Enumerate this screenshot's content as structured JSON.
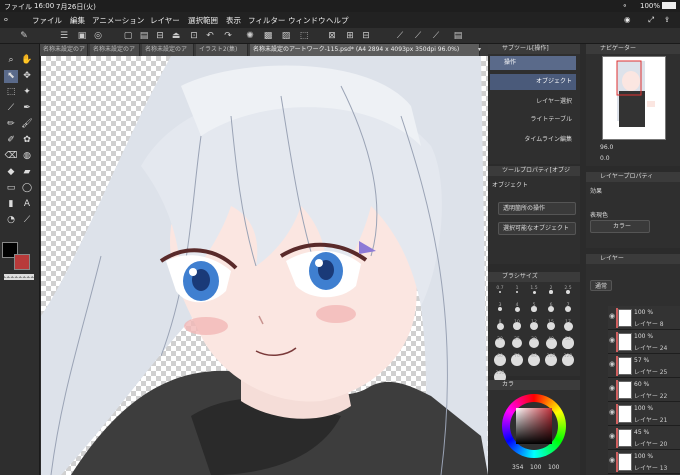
{
  "status": {
    "app": "ファイル",
    "time": "16:00",
    "date": "7月26日(火)",
    "battery": "100%"
  },
  "menu": [
    "ファイル",
    "編集",
    "アニメーション",
    "レイヤー",
    "選択範囲",
    "表示",
    "フィルター",
    "ウィンドウ",
    "ヘルプ"
  ],
  "tabs": [
    "名称未設定のア",
    "名称未設定のア",
    "名称未設定のア",
    "イラスト2(集)",
    "名称未設定のアートワーク-115.psd* (A4 2894 x 4093px 350dpi 96.0%)"
  ],
  "subtool": {
    "title": "サブツール[操作]",
    "items": [
      "操作",
      "オブジェクト",
      "レイヤー選択",
      "ライトテーブル",
      "タイムライン編集"
    ]
  },
  "toolprop": {
    "title": "ツールプロパティ[オブジ",
    "label": "オブジェクト",
    "dropdown1": "透明箇所の操作",
    "dropdown2": "選択可能なオブジェクト"
  },
  "brushsize": {
    "title": "ブラシサイズ",
    "sizes": [
      "0.7",
      "1",
      "1.5",
      "2",
      "2.5",
      "3",
      "4",
      "5",
      "6",
      "7",
      "8",
      "10",
      "12",
      "15",
      "17",
      "20",
      "25",
      "30",
      "40",
      "50",
      "60",
      "70",
      "80",
      "100",
      "120",
      "150"
    ]
  },
  "color": {
    "tab": "カラ",
    "readout": "354",
    "readout2": "100",
    "readout3": "100",
    "hue_color": "#c0303a"
  },
  "navigator": {
    "title": "ナビゲーター",
    "zoom": "96.0",
    "angle": "0.0"
  },
  "layerprop": {
    "title": "レイヤープロパティ",
    "effect_label": "効果",
    "expression_label": "表現色",
    "expression_value": "カラー"
  },
  "layers": {
    "title": "レイヤー",
    "blend": "通常",
    "opacity": "100",
    "rows": [
      {
        "pct": "100 %",
        "name": "レイヤー 8"
      },
      {
        "pct": "100 %",
        "name": "レイヤー 24"
      },
      {
        "pct": "57 %",
        "name": "レイヤー 25"
      },
      {
        "pct": "60 %",
        "name": "レイヤー 22"
      },
      {
        "pct": "100 %",
        "name": "レイヤー 21"
      },
      {
        "pct": "45 %",
        "name": "レイヤー 20"
      },
      {
        "pct": "100 %",
        "name": "レイヤー 13"
      }
    ]
  }
}
